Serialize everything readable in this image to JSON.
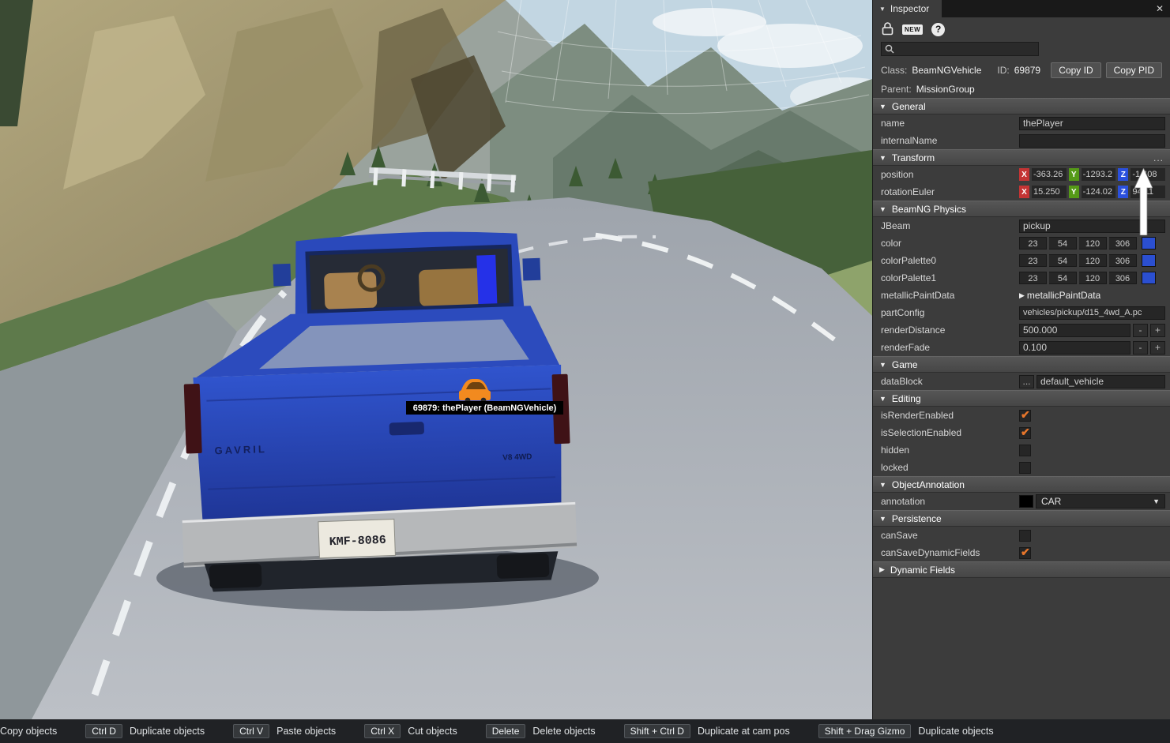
{
  "icons": {
    "panel_tab_arrow": "▼",
    "close": "✕",
    "new_badge": "NEW",
    "help": "?",
    "collapse_open": "▼",
    "collapse_closed": "▶",
    "dropdown_arrow": "▼",
    "minus": "-",
    "plus": "+",
    "more": "..."
  },
  "axes": {
    "x": "X",
    "y": "Y",
    "z": "Z"
  },
  "viewport": {
    "selection_label": "69879: thePlayer (BeamNGVehicle)",
    "license_plate": "KMF-8086",
    "tailgate_brand": "GAVRIL",
    "tailgate_badge": "V8 4WD"
  },
  "inspector": {
    "tab_title": "Inspector",
    "search": {
      "placeholder": ""
    },
    "meta": {
      "class_label": "Class:",
      "class_value": "BeamNGVehicle",
      "id_label": "ID:",
      "id_value": "69879",
      "copy_id": "Copy ID",
      "copy_pid": "Copy PID",
      "parent_label": "Parent:",
      "parent_value": "MissionGroup"
    },
    "general": {
      "title": "General",
      "name_label": "name",
      "name_value": "thePlayer",
      "internal_label": "internalName",
      "internal_value": ""
    },
    "transform": {
      "title": "Transform",
      "more": "...",
      "position_label": "position",
      "position": {
        "x": "-363.26",
        "y": "-1293.2",
        "z": "-1.408"
      },
      "rotation_label": "rotationEuler",
      "rotation": {
        "x": "15.250",
        "y": "-124.02",
        "z": "94.11"
      }
    },
    "physics": {
      "title": "BeamNG Physics",
      "jbeam_label": "JBeam",
      "jbeam_value": "pickup",
      "color_label": "color",
      "color_values": [
        "23",
        "54",
        "120",
        "306"
      ],
      "palette0_label": "colorPalette0",
      "palette0_values": [
        "23",
        "54",
        "120",
        "306"
      ],
      "palette1_label": "colorPalette1",
      "palette1_values": [
        "23",
        "54",
        "120",
        "306"
      ],
      "swatch_color": "#2b4fd0",
      "metallic_label": "metallicPaintData",
      "metallic_value": "metallicPaintData",
      "partconfig_label": "partConfig",
      "partconfig_value": "vehicles/pickup/d15_4wd_A.pc",
      "renderdistance_label": "renderDistance",
      "renderdistance_value": "500.000",
      "renderfade_label": "renderFade",
      "renderfade_value": "0.100"
    },
    "game": {
      "title": "Game",
      "datablock_label": "dataBlock",
      "datablock_value": "default_vehicle"
    },
    "editing": {
      "title": "Editing",
      "rows": [
        {
          "label": "isRenderEnabled",
          "checked": true
        },
        {
          "label": "isSelectionEnabled",
          "checked": true
        },
        {
          "label": "hidden",
          "checked": false
        },
        {
          "label": "locked",
          "checked": false
        }
      ]
    },
    "annotation": {
      "title": "ObjectAnnotation",
      "label": "annotation",
      "value": "CAR",
      "swatch_color": "#000000"
    },
    "persistence": {
      "title": "Persistence",
      "rows": [
        {
          "label": "canSave",
          "checked": false
        },
        {
          "label": "canSaveDynamicFields",
          "checked": true
        }
      ]
    },
    "dynamic_fields": {
      "title": "Dynamic Fields"
    }
  },
  "statusbar": {
    "items": [
      {
        "key": "",
        "label": "Copy objects"
      },
      {
        "key": "Ctrl D",
        "label": "Duplicate objects"
      },
      {
        "key": "Ctrl V",
        "label": "Paste objects"
      },
      {
        "key": "Ctrl X",
        "label": "Cut objects"
      },
      {
        "key": "Delete",
        "label": "Delete objects"
      },
      {
        "key": "Shift + Ctrl D",
        "label": "Duplicate at cam pos"
      },
      {
        "key": "Shift + Drag Gizmo",
        "label": "Duplicate objects"
      }
    ]
  }
}
